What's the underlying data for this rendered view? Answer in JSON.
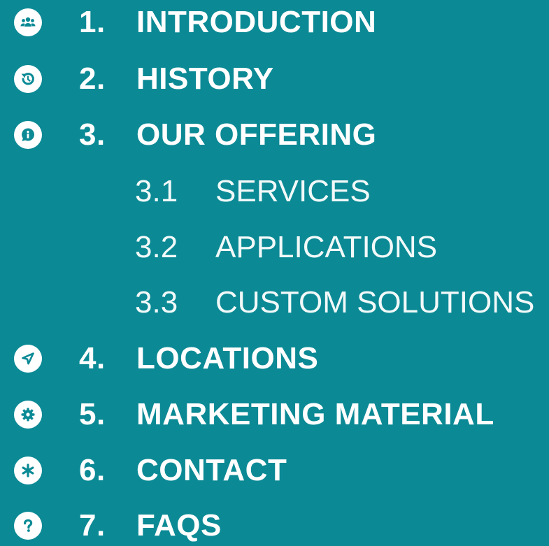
{
  "accent_color": "#0b8a95",
  "items": [
    {
      "number": "1.",
      "label": "INTRODUCTION",
      "icon": "users-icon"
    },
    {
      "number": "2.",
      "label": "HISTORY",
      "icon": "history-icon"
    },
    {
      "number": "3.",
      "label": "OUR OFFERING",
      "icon": "info-icon"
    },
    {
      "number": "3.1",
      "label": "SERVICES"
    },
    {
      "number": "3.2",
      "label": "APPLICATIONS"
    },
    {
      "number": "3.3",
      "label": "CUSTOM SOLUTIONS"
    },
    {
      "number": "4.",
      "label": "LOCATIONS",
      "icon": "location-arrow-icon"
    },
    {
      "number": "5.",
      "label": "MARKETING MATERIAL",
      "icon": "gear-icon"
    },
    {
      "number": "6.",
      "label": "CONTACT",
      "icon": "asterisk-icon"
    },
    {
      "number": "7.",
      "label": "FAQS",
      "icon": "question-icon"
    }
  ]
}
